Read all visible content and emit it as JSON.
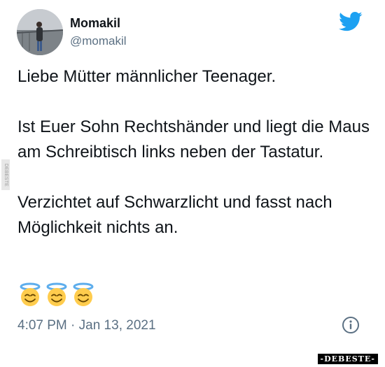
{
  "tweet": {
    "display_name": "Momakil",
    "handle": "@momakil",
    "paragraphs": [
      "Liebe Mütter männlicher Teenager.",
      "Ist Euer Sohn Rechtshänder und liegt die Maus am Schreibtisch links neben der Tastatur.",
      "Verzichtet auf Schwarzlicht und fasst nach Möglichkeit nichts an."
    ],
    "emojis": [
      "smiling-face-with-halo",
      "smiling-face-with-halo",
      "smiling-face-with-halo"
    ],
    "timestamp": "4:07 PM · Jan 13, 2021"
  },
  "icons": {
    "brand": "twitter-bird-icon",
    "info": "info-icon"
  },
  "colors": {
    "twitter_blue": "#1da1f2",
    "text_primary": "#0f1419",
    "text_secondary": "#5b7083"
  },
  "watermark": {
    "text": "-DEBESTE-"
  },
  "side_tag": {
    "text": "DEBESTE"
  }
}
